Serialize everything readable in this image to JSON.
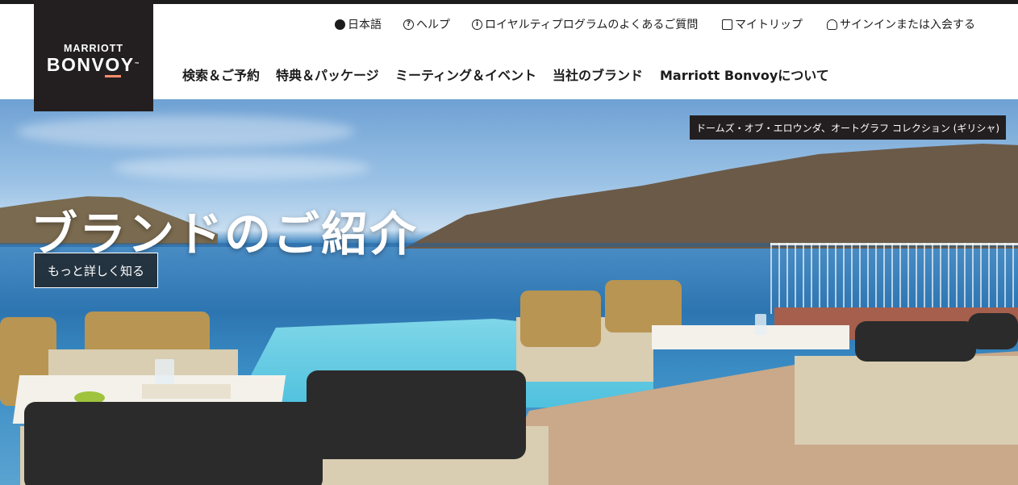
{
  "logo": {
    "line1": "MARRIOTT",
    "line2": "BONV",
    "line2_accent": "O",
    "line2_tail": "Y",
    "tm": "™"
  },
  "utility_nav": {
    "language": "日本語",
    "help": "ヘルプ",
    "faq": "ロイヤルティプログラムのよくあるご質問",
    "my_trips": "マイトリップ",
    "signin": "サインインまたは入会する"
  },
  "icons": {
    "language": "globe-icon",
    "help": "question-icon",
    "faq": "info-icon",
    "my_trips": "suitcase-icon",
    "signin": "user-icon"
  },
  "main_nav": {
    "search": "検索＆ご予約",
    "offers": "特典＆パッケージ",
    "meetings": "ミーティング＆イベント",
    "brands": "当社のブランド",
    "about": "Marriott Bonvoyについて"
  },
  "hero": {
    "caption": "ドームズ・オブ・エロウンダ、オートグラフ コレクション (ギリシャ)",
    "title": "ブランドのご紹介",
    "cta": "もっと詳しく知る"
  },
  "colors": {
    "logo_bg": "#231f20",
    "accent": "#ff8d6b",
    "text": "#1c1c1c"
  }
}
